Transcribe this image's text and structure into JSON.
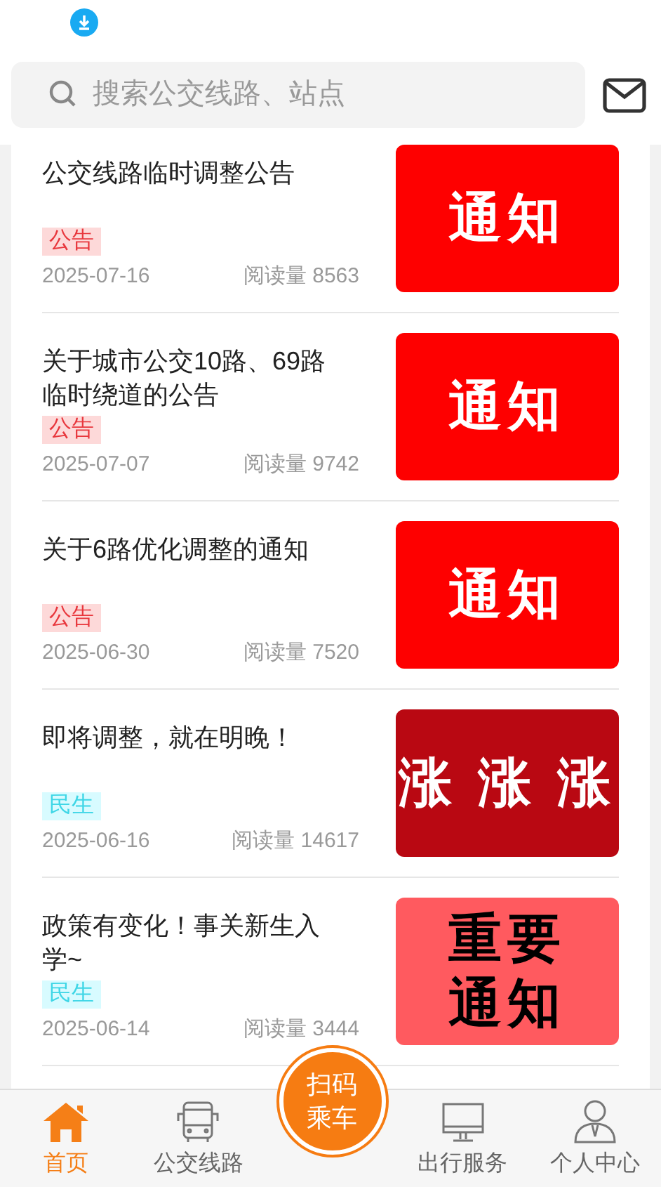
{
  "search": {
    "placeholder": "搜索公交线路、站点"
  },
  "news": [
    {
      "title": "公交线路临时调整公告",
      "tag": {
        "label": "公告",
        "kind": "notice"
      },
      "date": "2025-07-16",
      "reads": "阅读量 8563",
      "thumb": {
        "lines": [
          "通知"
        ],
        "color": "#fe0000",
        "kind": "light"
      }
    },
    {
      "title": "关于城市公交10路、69路临时绕道的公告",
      "tag": {
        "label": "公告",
        "kind": "notice"
      },
      "date": "2025-07-07",
      "reads": "阅读量 9742",
      "thumb": {
        "lines": [
          "通知"
        ],
        "color": "#fe0000",
        "kind": "light"
      }
    },
    {
      "title": "关于6路优化调整的通知",
      "tag": {
        "label": "公告",
        "kind": "notice"
      },
      "date": "2025-06-30",
      "reads": "阅读量 7520",
      "thumb": {
        "lines": [
          "通知"
        ],
        "color": "#fe0000",
        "kind": "light"
      }
    },
    {
      "title": "即将调整，就在明晚！",
      "tag": {
        "label": "民生",
        "kind": "life"
      },
      "date": "2025-06-16",
      "reads": "阅读量 14617",
      "thumb": {
        "lines": [
          "涨 涨 涨"
        ],
        "color": "#b90812",
        "kind": "light"
      }
    },
    {
      "title": "政策有变化！事关新生入学~",
      "tag": {
        "label": "民生",
        "kind": "life"
      },
      "date": "2025-06-14",
      "reads": "阅读量 3444",
      "thumb": {
        "lines": [
          "重要",
          "通知"
        ],
        "color": "#ff5a5f",
        "kind": "dark"
      }
    }
  ],
  "nav": [
    {
      "label": "首页",
      "kind": "home",
      "selected": true
    },
    {
      "label": "公交线路",
      "kind": "bus",
      "selected": false
    },
    {
      "label": "扫码乘车",
      "kind": "scan",
      "selected": false
    },
    {
      "label": "出行服务",
      "kind": "service",
      "selected": false
    },
    {
      "label": "个人中心",
      "kind": "user",
      "selected": false
    }
  ]
}
